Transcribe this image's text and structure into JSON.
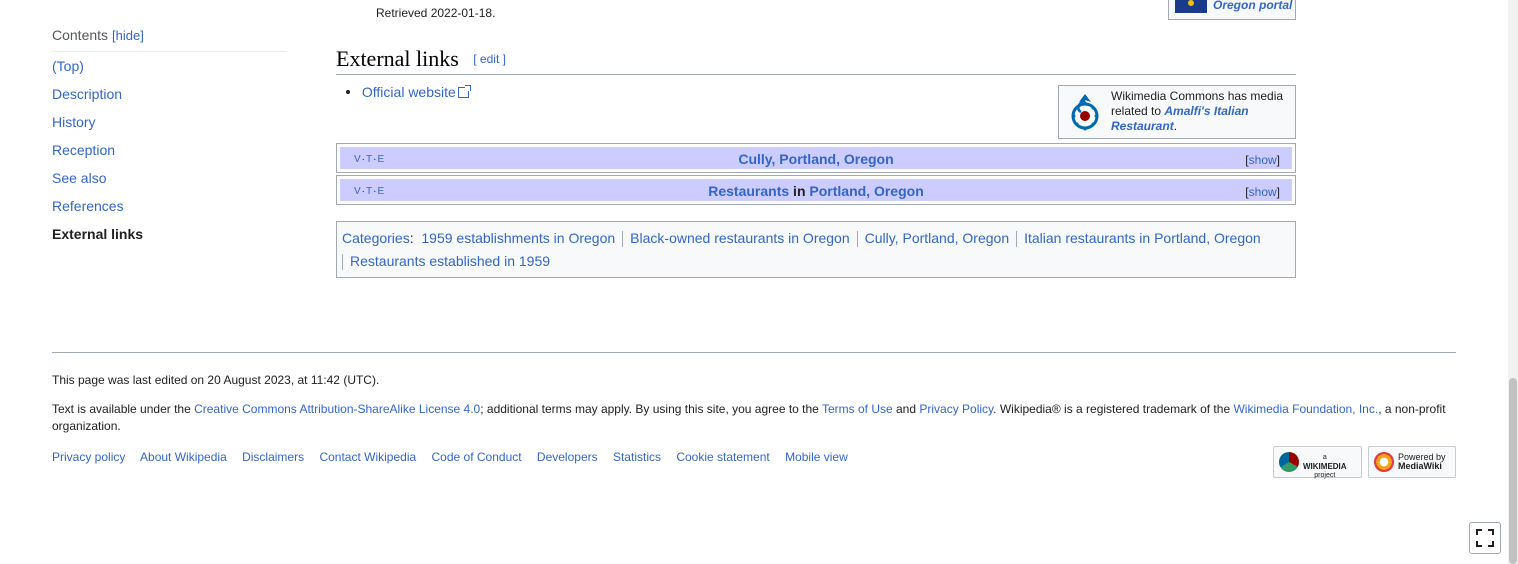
{
  "toc": {
    "title": "Contents",
    "hide_label": "[hide]",
    "items": [
      "(Top)",
      "Description",
      "History",
      "Reception",
      "See also",
      "References",
      "External links"
    ]
  },
  "reference": {
    "retrieved": "Retrieved 2022-01-18."
  },
  "portal": {
    "label": "Oregon portal"
  },
  "section": {
    "heading": "External links",
    "edit_label": "[ edit ]"
  },
  "external_links": [
    "Official website"
  ],
  "commons": {
    "text_before": "Wikimedia Commons has media related to ",
    "link": "Amalfi's Italian Restaurant",
    "text_after": "."
  },
  "navboxes": [
    {
      "vte": [
        "V",
        "T",
        "E"
      ],
      "title_parts": [
        "Cully, Portland, Oregon"
      ],
      "show_label": "show"
    },
    {
      "vte": [
        "V",
        "T",
        "E"
      ],
      "title_link1": "Restaurants",
      "title_mid": " in ",
      "title_link2": "Portland, Oregon",
      "show_label": "show"
    }
  ],
  "categories": {
    "label": "Categories",
    "items": [
      "1959 establishments in Oregon",
      "Black-owned restaurants in Oregon",
      "Cully, Portland, Oregon",
      "Italian restaurants in Portland, Oregon",
      "Restaurants established in 1959"
    ]
  },
  "footer": {
    "last_edited": "This page was last edited on 20 August 2023, at 11:42 (UTC).",
    "license_prefix": "Text is available under the ",
    "license_link": "Creative Commons Attribution-ShareAlike License 4.0",
    "license_mid1": "; additional terms may apply. By using this site, you agree to the ",
    "terms_link": "Terms of Use",
    "and": " and ",
    "privacy_link": "Privacy Policy",
    "license_mid2": ". Wikipedia® is a registered trademark of the ",
    "wmf_link": "Wikimedia Foundation, Inc.",
    "license_end": ", a non-profit organization.",
    "places": [
      "Privacy policy",
      "About Wikipedia",
      "Disclaimers",
      "Contact Wikipedia",
      "Code of Conduct",
      "Developers",
      "Statistics",
      "Cookie statement",
      "Mobile view"
    ],
    "wikimedia_badge": [
      "a",
      "WIKIMEDIA",
      "project"
    ],
    "mediawiki_badge": [
      "Powered by",
      "MediaWiki"
    ]
  },
  "colors": {
    "link": "#3366cc",
    "navbox_header": "#ccccff",
    "border": "#a2a9b1"
  },
  "icons": [
    "external-link-icon",
    "commons-logo-icon",
    "fullscreen-icon",
    "oregon-flag-icon"
  ]
}
